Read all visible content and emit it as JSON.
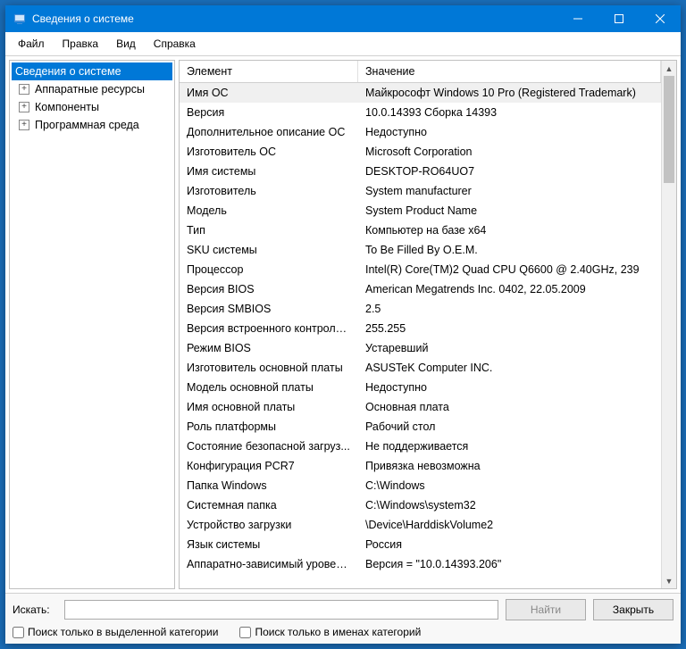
{
  "titlebar": {
    "title": "Сведения о системе"
  },
  "menu": {
    "file": "Файл",
    "edit": "Правка",
    "view": "Вид",
    "help": "Справка"
  },
  "tree": {
    "root": "Сведения о системе",
    "children": [
      {
        "label": "Аппаратные ресурсы"
      },
      {
        "label": "Компоненты"
      },
      {
        "label": "Программная среда"
      }
    ]
  },
  "columns": {
    "key": "Элемент",
    "value": "Значение"
  },
  "rows": [
    {
      "k": "Имя ОС",
      "v": "Майкрософт Windows 10 Pro (Registered Trademark)"
    },
    {
      "k": "Версия",
      "v": "10.0.14393 Сборка 14393"
    },
    {
      "k": "Дополнительное описание ОС",
      "v": "Недоступно"
    },
    {
      "k": "Изготовитель ОС",
      "v": "Microsoft Corporation"
    },
    {
      "k": "Имя системы",
      "v": "DESKTOP-RO64UO7"
    },
    {
      "k": "Изготовитель",
      "v": "System manufacturer"
    },
    {
      "k": "Модель",
      "v": "System Product Name"
    },
    {
      "k": "Тип",
      "v": "Компьютер на базе x64"
    },
    {
      "k": "SKU системы",
      "v": "To Be Filled By O.E.M."
    },
    {
      "k": "Процессор",
      "v": "Intel(R) Core(TM)2 Quad CPU    Q6600  @ 2.40GHz, 239"
    },
    {
      "k": "Версия BIOS",
      "v": "American Megatrends Inc. 0402, 22.05.2009"
    },
    {
      "k": "Версия SMBIOS",
      "v": "2.5"
    },
    {
      "k": "Версия встроенного контролл...",
      "v": "255.255"
    },
    {
      "k": "Режим BIOS",
      "v": "Устаревший"
    },
    {
      "k": "Изготовитель основной платы",
      "v": "ASUSTeK Computer INC."
    },
    {
      "k": "Модель основной платы",
      "v": "Недоступно"
    },
    {
      "k": "Имя основной платы",
      "v": "Основная плата"
    },
    {
      "k": "Роль платформы",
      "v": "Рабочий стол"
    },
    {
      "k": "Состояние безопасной загруз...",
      "v": "Не поддерживается"
    },
    {
      "k": "Конфигурация PCR7",
      "v": "Привязка невозможна"
    },
    {
      "k": "Папка Windows",
      "v": "C:\\Windows"
    },
    {
      "k": "Системная папка",
      "v": "C:\\Windows\\system32"
    },
    {
      "k": "Устройство загрузки",
      "v": "\\Device\\HarddiskVolume2"
    },
    {
      "k": "Язык системы",
      "v": "Россия"
    },
    {
      "k": "Аппаратно-зависимый уровен...",
      "v": "Версия = \"10.0.14393.206\""
    }
  ],
  "search": {
    "label": "Искать:",
    "find": "Найти",
    "close": "Закрыть",
    "check1": "Поиск только в выделенной категории",
    "check2": "Поиск только в именах категорий"
  }
}
